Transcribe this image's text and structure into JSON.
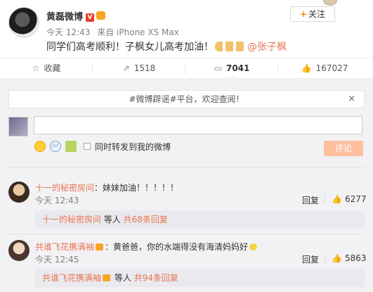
{
  "post": {
    "author": "黄磊微博",
    "vbadge": "V",
    "follow_label": "关注",
    "follow_plus": "+",
    "time": "今天 12:43",
    "source": "来自 iPhone XS Max",
    "text": "同学们高考顺利！子枫女儿高考加油！",
    "mention": "@张子枫"
  },
  "actions": {
    "favorite": "收藏",
    "repost": "1518",
    "comment": "7041",
    "like": "167027"
  },
  "composer": {
    "notice": "#微博辟谣#平台，欢迎查阅！",
    "notice_close": "×",
    "gif_label": "GIF",
    "also_repost_label": "同时转发到我的微博",
    "submit_label": "评论"
  },
  "comments": [
    {
      "user": "十一的秘密房间",
      "text": "：妹妹加油！！！！！",
      "time": "今天 12:43",
      "reply_label": "回复",
      "likes": "6277",
      "sub_user": "十一的秘密房间",
      "sub_mid": " 等人 ",
      "sub_count": "共68条回复"
    },
    {
      "user": "共谁飞花携满袖",
      "text": "：黄爸爸，你的水端得没有海清妈妈好",
      "time": "今天 12:45",
      "reply_label": "回复",
      "likes": "5863",
      "sub_user": "共谁飞花携满袖",
      "sub_mid": " 等人 ",
      "sub_count": "共94条回复"
    }
  ]
}
